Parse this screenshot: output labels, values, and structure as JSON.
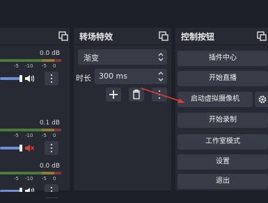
{
  "panels": {
    "transitions": {
      "title": "转场特效"
    },
    "controls": {
      "title": "控制按钮"
    }
  },
  "mixer": {
    "channels": [
      {
        "db": "0.0 dB",
        "muted": false
      },
      {
        "db": "0.1 dB",
        "muted": true
      },
      {
        "db": "0.0 dB",
        "muted": false
      }
    ],
    "tick_labels": [
      "-5",
      "-10",
      "-5",
      "0"
    ]
  },
  "transitions": {
    "selected": "渐变",
    "duration_label": "时长",
    "duration_value": "300 ms"
  },
  "controls": {
    "plugin_center": "插件中心",
    "start_streaming": "开始直播",
    "start_virtual_camera": "启动虚拟摄像机",
    "start_recording": "开始录制",
    "studio_mode": "工作室模式",
    "settings": "设置",
    "exit": "退出"
  },
  "colors": {
    "background": "#1e2027",
    "panel": "#272a33",
    "button": "#383c47",
    "annotation_arrow": "#e03a3a",
    "muted_icon": "#d94040"
  },
  "icons": [
    "dock-undock-icon",
    "speaker-icon",
    "speaker-muted-icon",
    "kebab-menu-icon",
    "plus-icon",
    "trash-icon",
    "gear-icon",
    "chevron-updown-icon"
  ]
}
